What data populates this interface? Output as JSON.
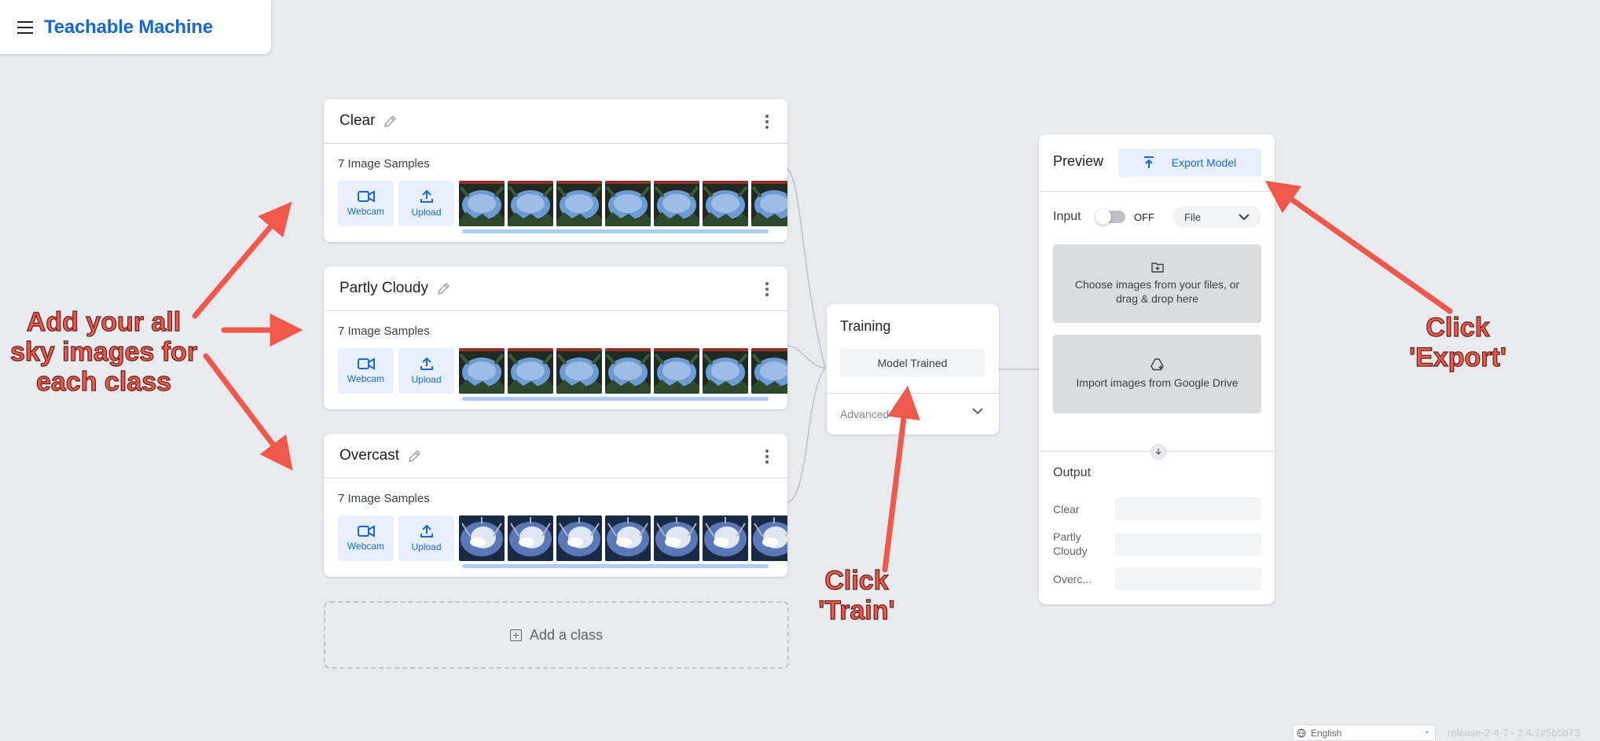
{
  "app": {
    "title": "Teachable Machine"
  },
  "classes": [
    {
      "name": "Clear",
      "samples_label": "7 Image Samples",
      "webcam_label": "Webcam",
      "upload_label": "Upload",
      "image_style": "dark-night"
    },
    {
      "name": "Partly Cloudy",
      "samples_label": "7 Image Samples",
      "webcam_label": "Webcam",
      "upload_label": "Upload",
      "image_style": "dark-night"
    },
    {
      "name": "Overcast",
      "samples_label": "7 Image Samples",
      "webcam_label": "Webcam",
      "upload_label": "Upload",
      "image_style": "bright-cloud"
    }
  ],
  "add_class_label": "Add a class",
  "training": {
    "title": "Training",
    "button_label": "Model Trained",
    "advanced_label": "Advanced"
  },
  "preview": {
    "title": "Preview",
    "export_label": "Export Model",
    "input_label": "Input",
    "toggle_state": "OFF",
    "source_value": "File",
    "choose_files_text": "Choose images from your files, or drag & drop here",
    "drive_text": "Import images from Google Drive",
    "output_title": "Output",
    "outputs": [
      {
        "label": "Clear"
      },
      {
        "label": "Partly Cloudy"
      },
      {
        "label": "Overc..."
      }
    ]
  },
  "footer": {
    "language": "English",
    "version": "release-2-4-7 - 2.4.7#5b5b73"
  },
  "annotations": {
    "add_images": "Add your all sky images for each class",
    "click_train": "Click 'Train'",
    "click_export": "Click 'Export'"
  },
  "colors": {
    "accent": "#1967d2",
    "annotation": "#f0584b",
    "button_bg": "#e8f0fe"
  }
}
